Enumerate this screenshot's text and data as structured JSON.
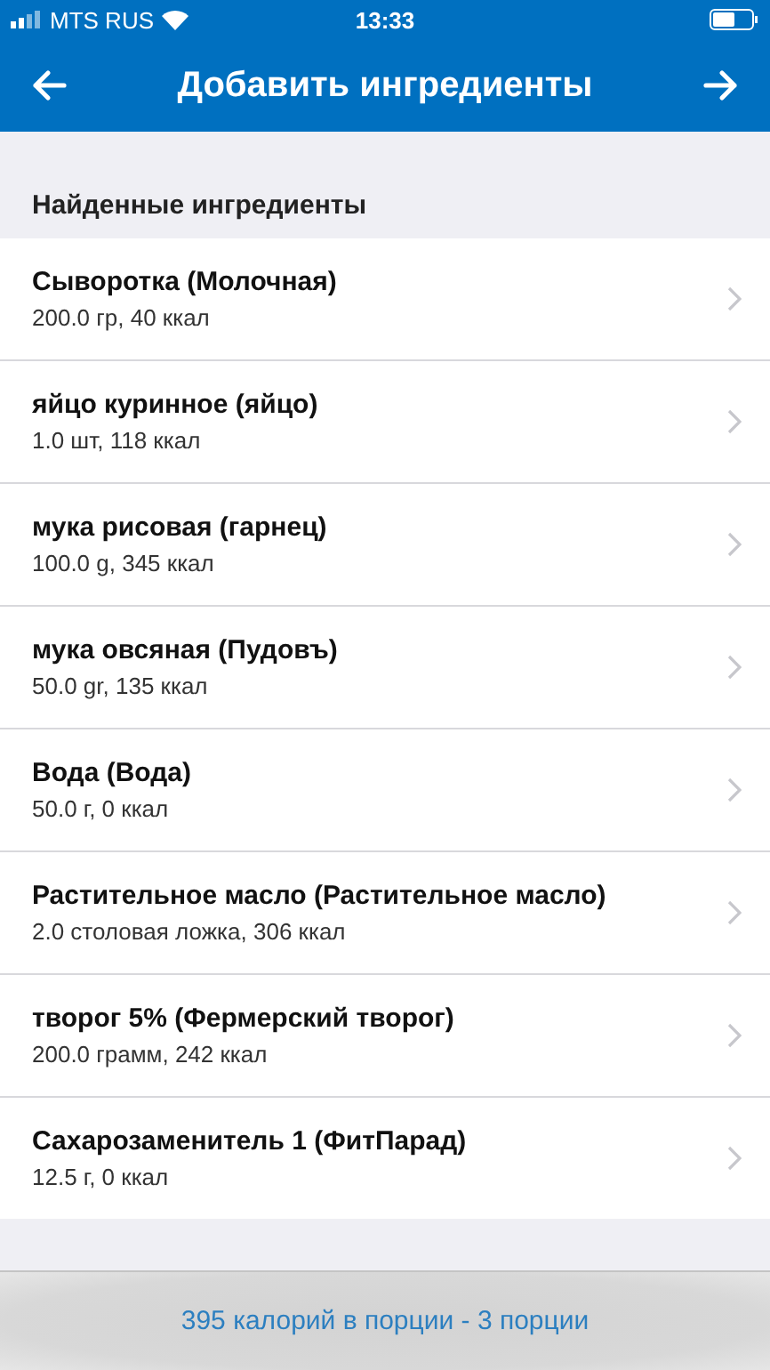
{
  "status_bar": {
    "carrier": "MTS RUS",
    "time": "13:33"
  },
  "nav": {
    "title": "Добавить ингредиенты"
  },
  "section": {
    "title": "Найденные ингредиенты"
  },
  "ingredients": [
    {
      "name": "Сыворотка (Молочная)",
      "detail": "200.0 гр, 40 ккал"
    },
    {
      "name": "яйцо куринное (яйцо)",
      "detail": "1.0 шт, 118 ккал"
    },
    {
      "name": "мука рисовая (гарнец)",
      "detail": "100.0 g, 345 ккал"
    },
    {
      "name": "мука овсяная (Пудовъ)",
      "detail": "50.0 gr, 135 ккал"
    },
    {
      "name": "Вода (Вода)",
      "detail": "50.0 г, 0 ккал"
    },
    {
      "name": "Растительное масло (Растительное масло)",
      "detail": "2.0 столовая ложка, 306 ккал"
    },
    {
      "name": "творог 5% (Фермерский творог)",
      "detail": "200.0 грамм, 242 ккал"
    },
    {
      "name": "Сахарозаменитель 1 (ФитПарад)",
      "detail": "12.5 г, 0 ккал"
    }
  ],
  "footer": {
    "summary": "395 калорий в порции - 3 порции"
  }
}
